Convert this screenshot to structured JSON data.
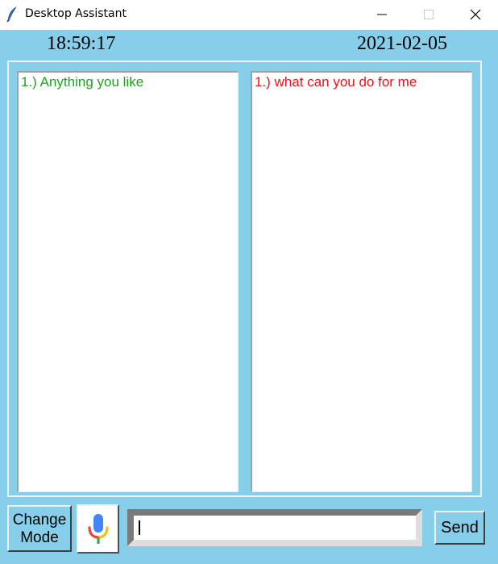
{
  "window": {
    "title": "Desktop Assistant",
    "background_color": "#87ceeb",
    "icon": "feather-icon"
  },
  "titlebar_controls": [
    "minimize-icon",
    "maximize-icon",
    "close-icon"
  ],
  "header": {
    "time": "18:59:17",
    "date": "2021-02-05"
  },
  "chat": {
    "left_panel": {
      "lines": [
        "1.) Anything you like"
      ],
      "text_color": "#22a022"
    },
    "right_panel": {
      "lines": [
        "1.) what can you do for me"
      ],
      "text_color": "#ee1111"
    }
  },
  "controls": {
    "change_mode_line1": "Change",
    "change_mode_line2": "Mode",
    "mic_icon": "microphone-icon",
    "input_value": "",
    "input_placeholder": "",
    "send_label": "Send"
  }
}
